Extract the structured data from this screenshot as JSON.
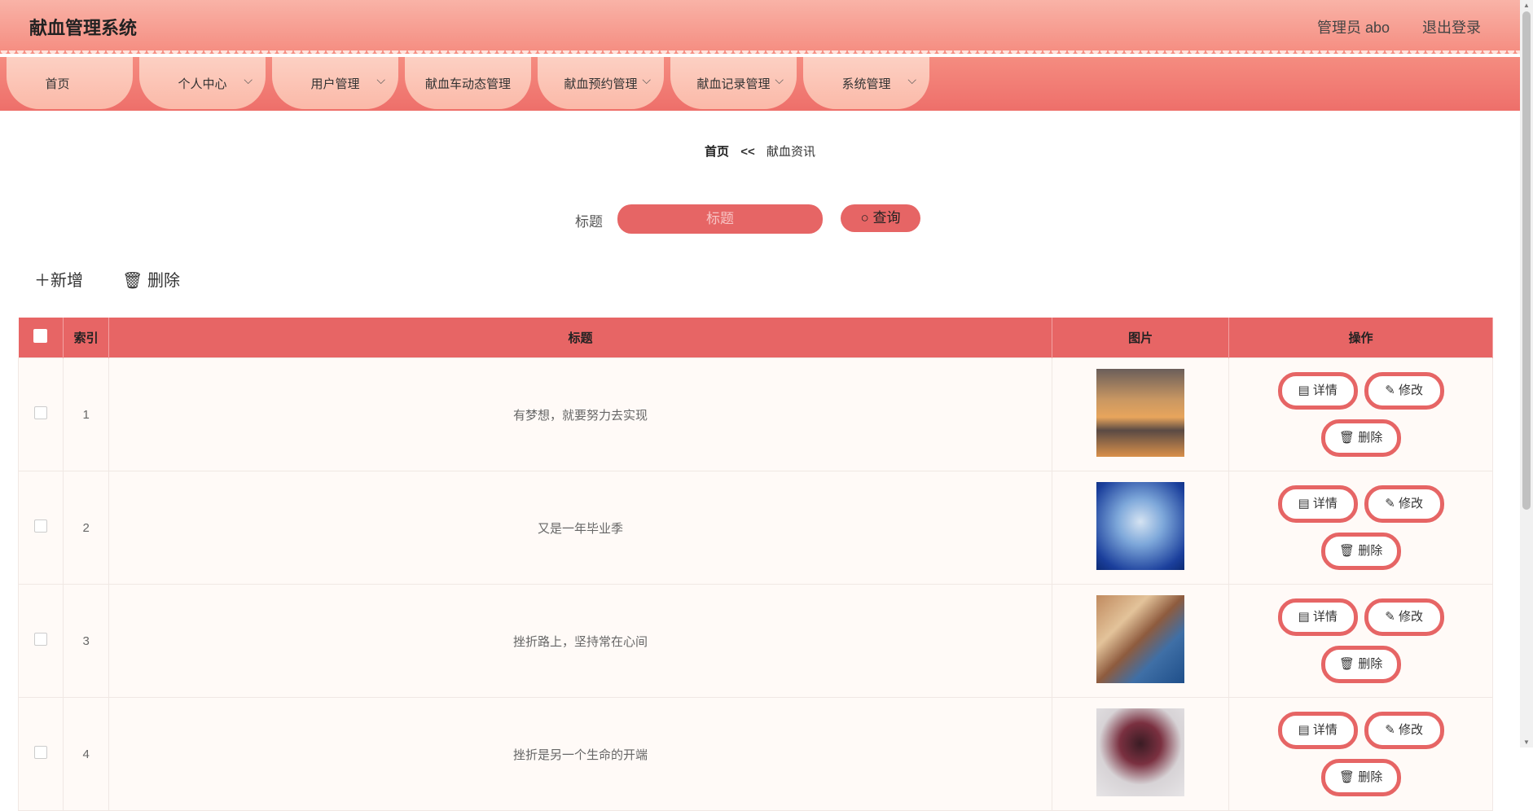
{
  "header": {
    "app_title": "献血管理系统",
    "user_label": "管理员 abo",
    "logout_label": "退出登录"
  },
  "nav": [
    {
      "label": "首页",
      "has_dropdown": false
    },
    {
      "label": "个人中心",
      "has_dropdown": true
    },
    {
      "label": "用户管理",
      "has_dropdown": true
    },
    {
      "label": "献血车动态管理",
      "has_dropdown": false
    },
    {
      "label": "献血预约管理",
      "has_dropdown": true
    },
    {
      "label": "献血记录管理",
      "has_dropdown": true
    },
    {
      "label": "系统管理",
      "has_dropdown": true
    }
  ],
  "breadcrumb": {
    "home": "首页",
    "separator": "<<",
    "current": "献血资讯"
  },
  "search": {
    "label": "标题",
    "placeholder": "标题",
    "button_label": "查询"
  },
  "toolbar": {
    "add_label": "新增",
    "delete_label": "删除"
  },
  "table": {
    "headers": {
      "index": "索引",
      "title": "标题",
      "image": "图片",
      "actions": "操作"
    },
    "actions": {
      "detail": "详情",
      "edit": "修改",
      "delete": "删除"
    },
    "rows": [
      {
        "index": "1",
        "title": "有梦想，就要努力去实现",
        "image": "sunset-clouds-photo"
      },
      {
        "index": "2",
        "title": "又是一年毕业季",
        "image": "blue-sky-lighthouse-photo"
      },
      {
        "index": "3",
        "title": "挫折路上，坚持常在心间",
        "image": "cliffside-village-photo"
      },
      {
        "index": "4",
        "title": "挫折是另一个生命的开端",
        "image": "flower-photo"
      }
    ]
  },
  "colors": {
    "accent": "#e66565",
    "header_top": "#f9b3a7",
    "nav_item": "#fcd0c3"
  }
}
